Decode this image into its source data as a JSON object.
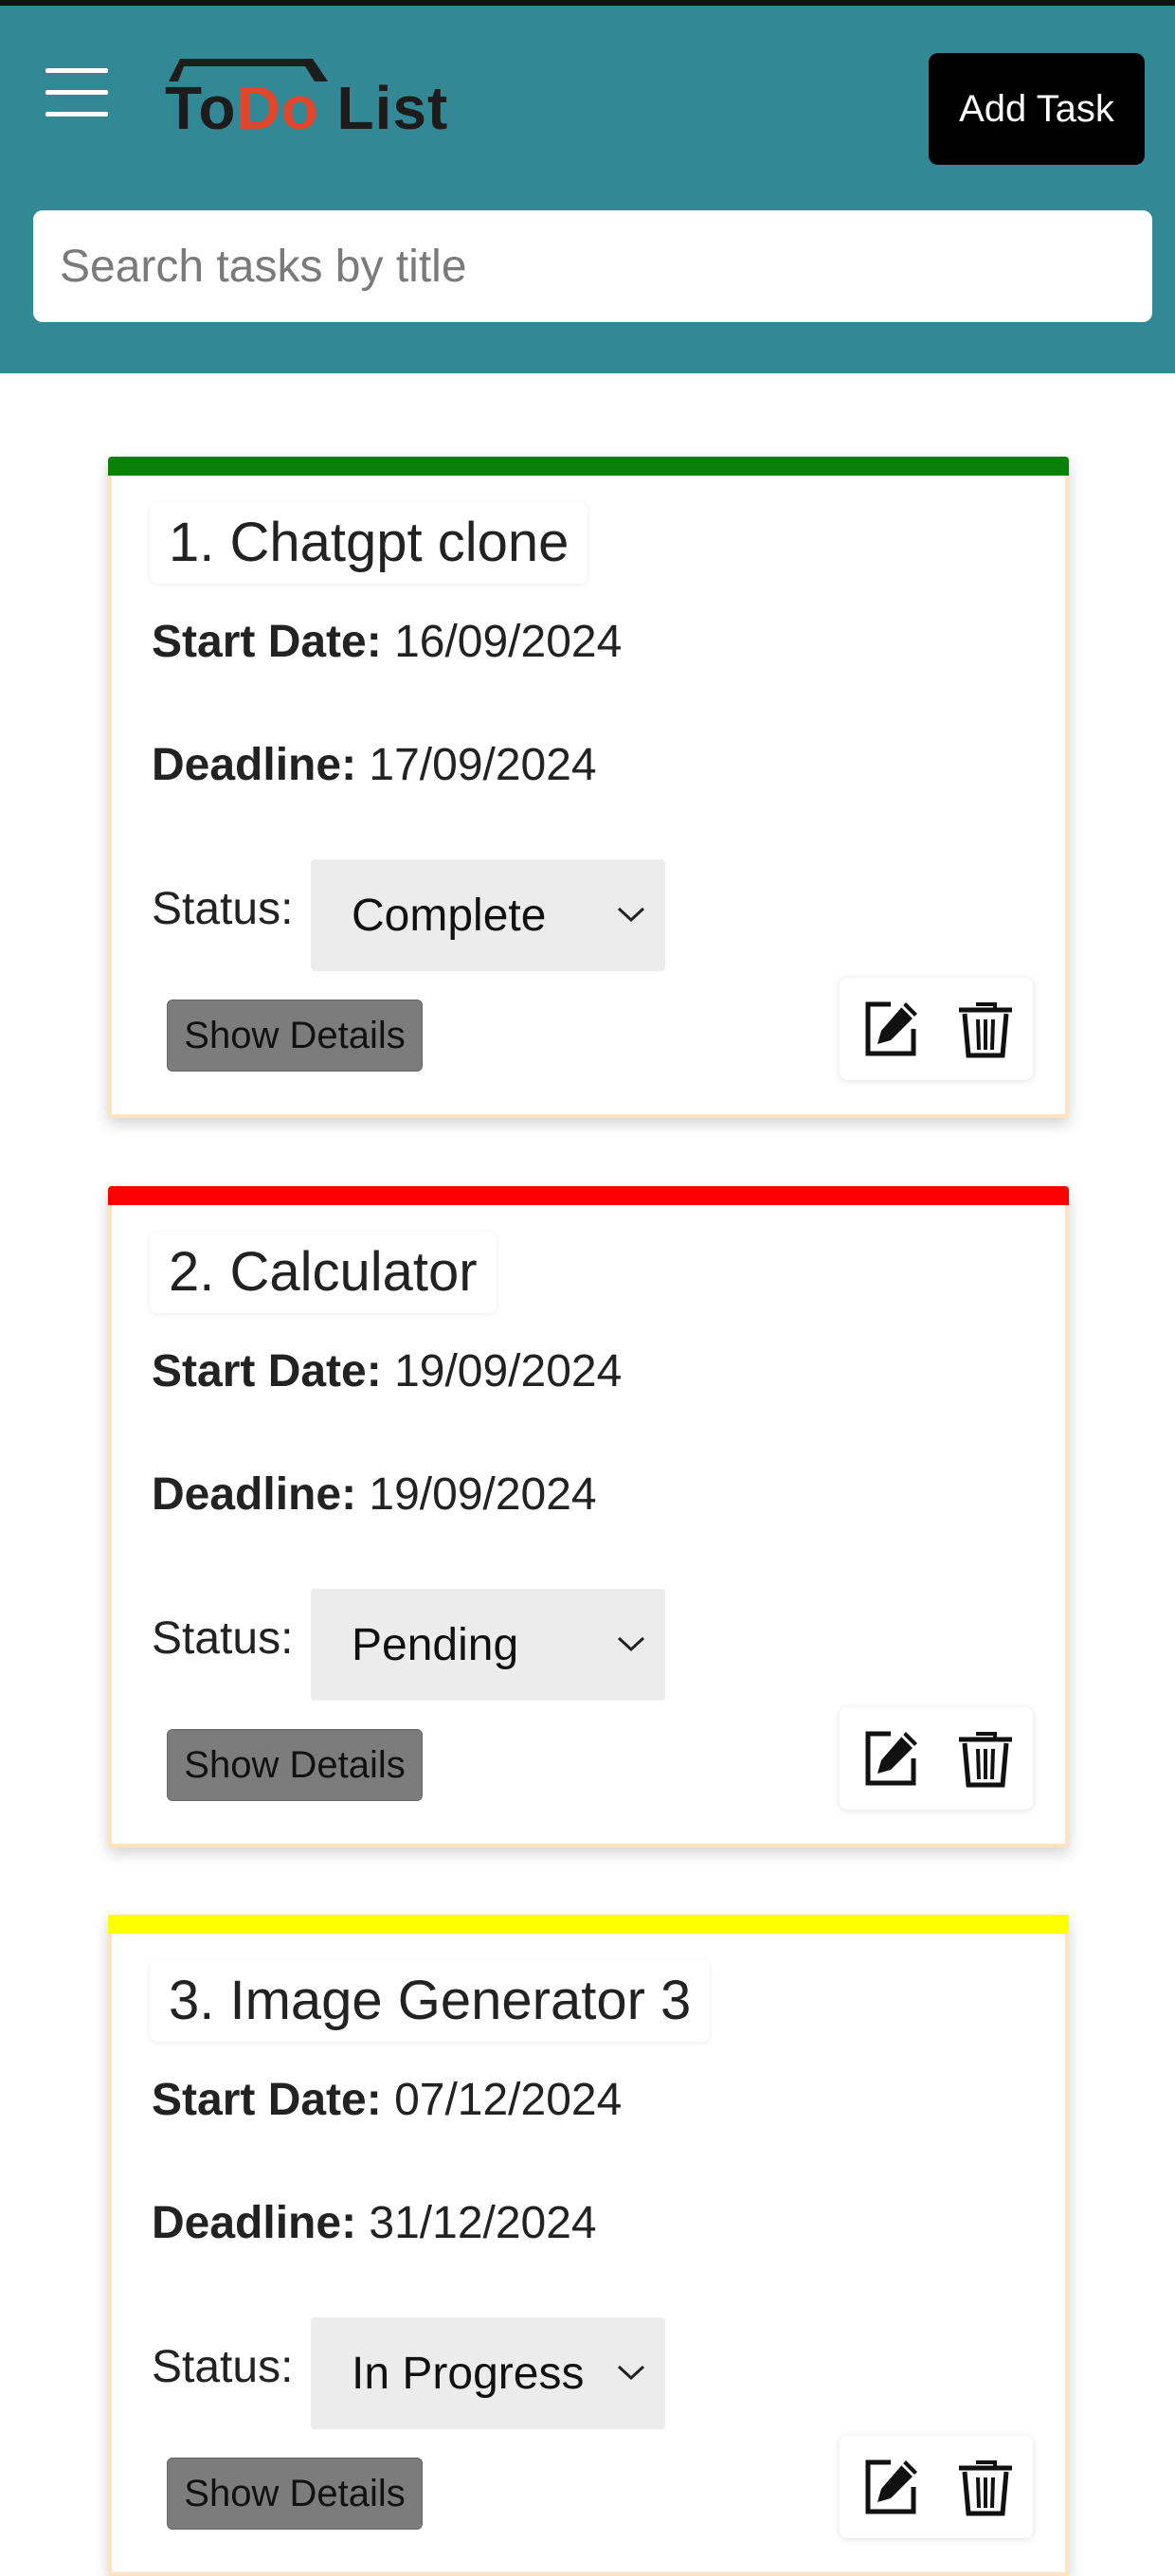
{
  "header": {
    "logo": {
      "part1": "To",
      "part2": "Do",
      "part3": " List"
    },
    "add_task_label": "Add Task",
    "search_placeholder": "Search tasks by title"
  },
  "labels": {
    "start_date": "Start Date:",
    "deadline": "Deadline:",
    "status": "Status:",
    "show_details": "Show Details"
  },
  "tasks": [
    {
      "title": "1. Chatgpt clone",
      "start_date": "16/09/2024",
      "deadline": "17/09/2024",
      "status": "Complete",
      "priority_color": "#078207"
    },
    {
      "title": "2. Calculator",
      "start_date": "19/09/2024",
      "deadline": "19/09/2024",
      "status": "Pending",
      "priority_color": "#ff0000"
    },
    {
      "title": "3. Image Generator 3",
      "start_date": "07/12/2024",
      "deadline": "31/12/2024",
      "status": "In Progress",
      "priority_color": "#ffff00"
    }
  ],
  "colors": {
    "header_bg": "#338896",
    "card_border": "#fbe3c3"
  },
  "icons": {
    "menu": "hamburger-icon",
    "edit": "edit-icon",
    "delete": "trash-icon",
    "dropdown": "chevron-down-icon"
  }
}
